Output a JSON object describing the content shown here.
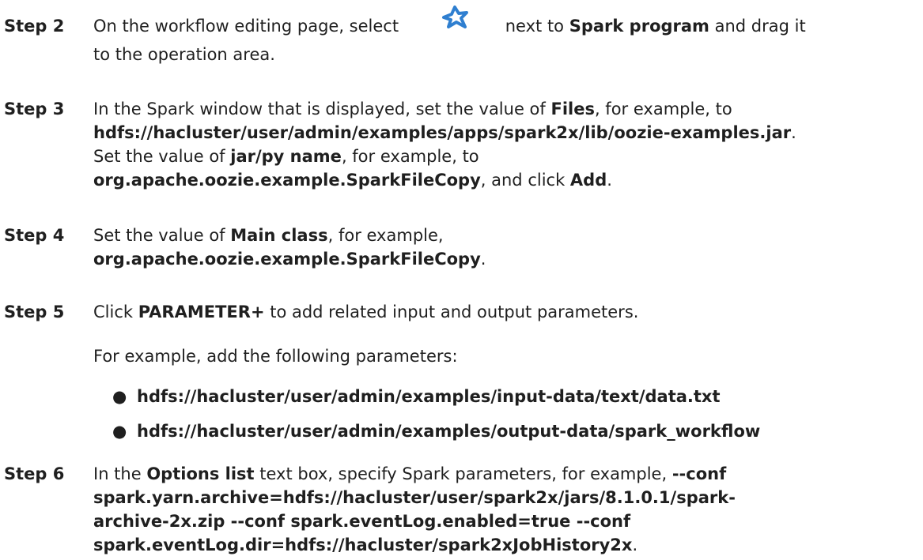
{
  "steps": [
    {
      "label": "Step 2",
      "lines": [
        [
          "On the workflow editing page, select ",
          {
            "icon": "spark-program-icon"
          },
          "next to ",
          {
            "b": "Spark program"
          },
          " and drag it"
        ],
        [
          "to the operation area."
        ]
      ]
    },
    {
      "label": "Step 3",
      "lines": [
        [
          "In the Spark window that is displayed, set the value of ",
          {
            "b": "Files"
          },
          ", for example, to"
        ],
        [
          {
            "b": "hdfs://hacluster/user/admin/examples/apps/spark2x/lib/oozie-examples.jar"
          },
          "."
        ],
        [
          "Set the value of ",
          {
            "b": "jar/py name"
          },
          ", for example, to"
        ],
        [
          {
            "b": "org.apache.oozie.example.SparkFileCopy"
          },
          ", and click ",
          {
            "b": "Add"
          },
          "."
        ]
      ]
    },
    {
      "label": "Step 4",
      "lines": [
        [
          "Set the value of ",
          {
            "b": "Main class"
          },
          ", for example,"
        ],
        [
          {
            "b": "org.apache.oozie.example.SparkFileCopy"
          },
          "."
        ]
      ]
    },
    {
      "label": "Step 5",
      "lines": [
        [
          "Click ",
          {
            "b": "PARAMETER+"
          },
          " to add related input and output parameters."
        ]
      ]
    },
    {
      "label": "Step 6",
      "lines": [
        [
          "In the ",
          {
            "b": "Options list"
          },
          " text box, specify Spark parameters, for example, ",
          {
            "b": "--conf"
          }
        ],
        [
          {
            "b": "spark.yarn.archive=hdfs://hacluster/user/spark2x/jars/8.1.0.1/spark-"
          }
        ],
        [
          {
            "b": "archive-2x.zip --conf spark.eventLog.enabled=true --conf"
          }
        ],
        [
          {
            "b": "spark.eventLog.dir=hdfs://hacluster/spark2xJobHistory2x"
          },
          "."
        ]
      ]
    }
  ],
  "step5_note": "For example, add the following parameters:",
  "step5_bullets": [
    "hdfs://hacluster/user/admin/examples/input-data/text/data.txt",
    "hdfs://hacluster/user/admin/examples/output-data/spark_workflow"
  ],
  "bullet_glyph": "●",
  "icon_colors": {
    "spark_program_icon": "#2f7fd0"
  }
}
